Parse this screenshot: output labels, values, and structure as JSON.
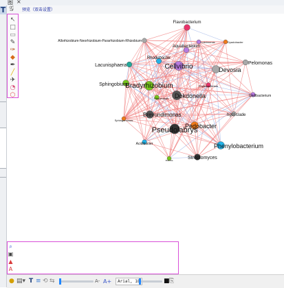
{
  "topbar": {
    "tab_icon": "图",
    "close_glyph": "×"
  },
  "header": {
    "logo_glyph": "𝒢",
    "hint": "预览（双击设置）"
  },
  "left_icon": "T",
  "colors": {
    "accent": "#d84fd8",
    "edge_red": "#f08080",
    "edge_blue": "#9ab0e6",
    "slider_knob": "#1f86ff"
  },
  "palette_tools": [
    {
      "name": "select-tool-icon",
      "glyph": "↖",
      "color": "#555"
    },
    {
      "name": "rectangle-tool-icon",
      "glyph": "□",
      "color": "#666"
    },
    {
      "name": "note-tool-icon",
      "glyph": "▭",
      "color": "#777"
    },
    {
      "name": "pencil-tool-icon",
      "glyph": "✎",
      "color": "#444"
    },
    {
      "name": "brush-tool-icon",
      "glyph": "✑",
      "color": "#b85c2a"
    },
    {
      "name": "paint-bucket-icon",
      "glyph": "◆",
      "color": "#d86a1a"
    },
    {
      "name": "pen-tool-icon",
      "glyph": "✒",
      "color": "#333"
    },
    {
      "name": "highlighter-icon",
      "glyph": "╱",
      "color": "#e0b000"
    },
    {
      "name": "pin-tool-icon",
      "glyph": "✈",
      "color": "#333"
    },
    {
      "name": "eraser-tool-icon",
      "glyph": "◔",
      "color": "#d9507a"
    },
    {
      "name": "shape-tool-icon",
      "glyph": "⬡",
      "color": "#e05050"
    }
  ],
  "bottom_tools": [
    {
      "name": "zoom-tool-icon",
      "glyph": "⌕",
      "color": "#3355cc"
    },
    {
      "name": "image-tool-icon",
      "glyph": "▣",
      "color": "#444"
    },
    {
      "name": "warning-tool-icon",
      "glyph": "▲",
      "color": "#d83a3a"
    },
    {
      "name": "text-size-icon",
      "glyph": "A",
      "color": "#d83a3a"
    }
  ],
  "statusbar": {
    "font_size_down": "A-",
    "font_size_up": "A+",
    "font_name": "Arial, 18",
    "text_tool": "T"
  },
  "graph": {
    "nodes": [
      {
        "label": "Flavobacterium",
        "color": "#e8336a",
        "size": 8
      },
      {
        "label": "Allorhizobium-Neorhizobium-Pararhizobium-Rhizobium",
        "color": "#a8a8a8",
        "size": 6
      },
      {
        "label": "Luteimonas",
        "color": "#b779e0",
        "size": 5
      },
      {
        "label": "Dyadobacter",
        "color": "#f07a1a",
        "size": 5
      },
      {
        "label": "Aquabacterium",
        "color": "#b779e0",
        "size": 7
      },
      {
        "label": "Lacunisphaera",
        "color": "#22a89a",
        "size": 7
      },
      {
        "label": "Rhodobacter",
        "color": "#22b2e8",
        "size": 7
      },
      {
        "label": "Cellvibrio",
        "color": "#b779e0",
        "size": 12
      },
      {
        "label": "Pelomonas",
        "color": "#a8a8a8",
        "size": 7
      },
      {
        "label": "Devosia",
        "color": "#a8a8a8",
        "size": 10
      },
      {
        "label": "Sphingobium",
        "color": "#78c41e",
        "size": 8
      },
      {
        "label": "Bradyrhizobium",
        "color": "#78c41e",
        "size": 12
      },
      {
        "label": "Phyllobacterium",
        "color": "#e8336a",
        "size": 6
      },
      {
        "label": "Undibacterium",
        "color": "#b779e0",
        "size": 6
      },
      {
        "label": "Rhizobacter",
        "color": "#78c41e",
        "size": 6
      },
      {
        "label": "Dokdonella",
        "color": "#555555",
        "size": 12
      },
      {
        "label": "Brevundimonas",
        "color": "#555555",
        "size": 10
      },
      {
        "label": "hgcI clade",
        "color": "#a8a8a8",
        "size": 6
      },
      {
        "label": "Sphingomonas",
        "color": "#f07a1a",
        "size": 5
      },
      {
        "label": "Pedobacter",
        "color": "#f07a1a",
        "size": 10
      },
      {
        "label": "Pseudolabrys",
        "color": "#333333",
        "size": 13
      },
      {
        "label": "Acidibacter",
        "color": "#22b2e8",
        "size": 6
      },
      {
        "label": "Phenylobacterium",
        "color": "#22b2e8",
        "size": 10
      },
      {
        "label": "Massilia",
        "color": "#78c41e",
        "size": 5
      },
      {
        "label": "Streptomyces",
        "color": "#333333",
        "size": 8
      }
    ]
  }
}
